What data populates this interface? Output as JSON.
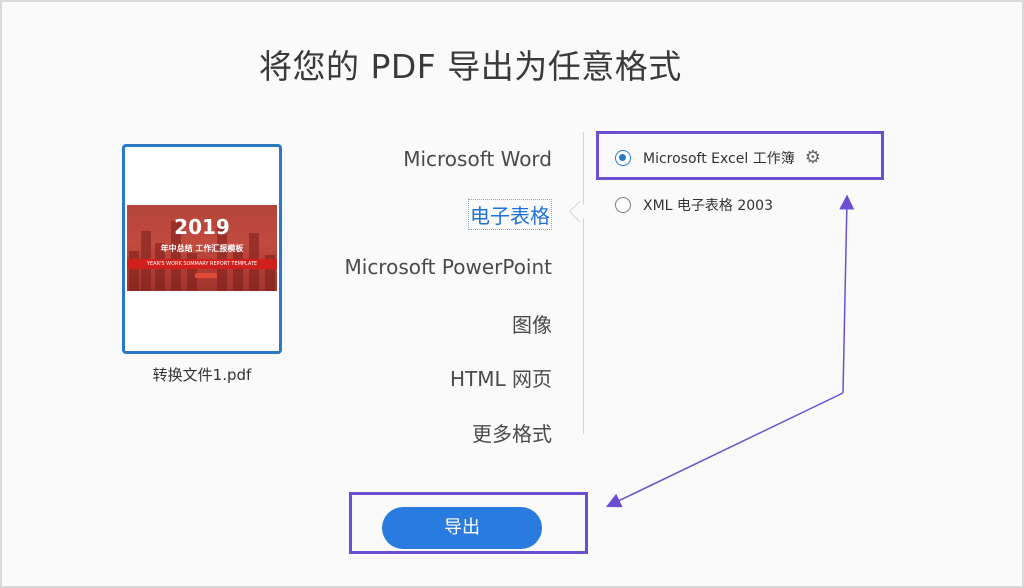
{
  "page": {
    "title": "将您的 PDF 导出为任意格式"
  },
  "file": {
    "name": "转换文件1.pdf",
    "thumbnail": {
      "year": "2019",
      "subtitle": "年中总结  工作汇报模板",
      "band": "YEAR'S WORK SUMMARY REPORT TEMPLATE"
    }
  },
  "formats": [
    {
      "label": "Microsoft Word",
      "selected": false
    },
    {
      "label": "电子表格",
      "selected": true
    },
    {
      "label": "Microsoft PowerPoint",
      "selected": false
    },
    {
      "label": "图像",
      "selected": false
    },
    {
      "label": "HTML 网页",
      "selected": false
    },
    {
      "label": "更多格式",
      "selected": false
    }
  ],
  "options": [
    {
      "label": "Microsoft Excel 工作簿",
      "checked": true,
      "has_settings": true
    },
    {
      "label": "XML 电子表格 2003",
      "checked": false,
      "has_settings": false
    }
  ],
  "export_button": {
    "label": "导出"
  },
  "colors": {
    "accent": "#2a7be0",
    "highlight": "#6c4fd1",
    "selected_text": "#1f73d8"
  },
  "icons": {
    "settings": "gear-icon",
    "radio": "radio-icon"
  }
}
